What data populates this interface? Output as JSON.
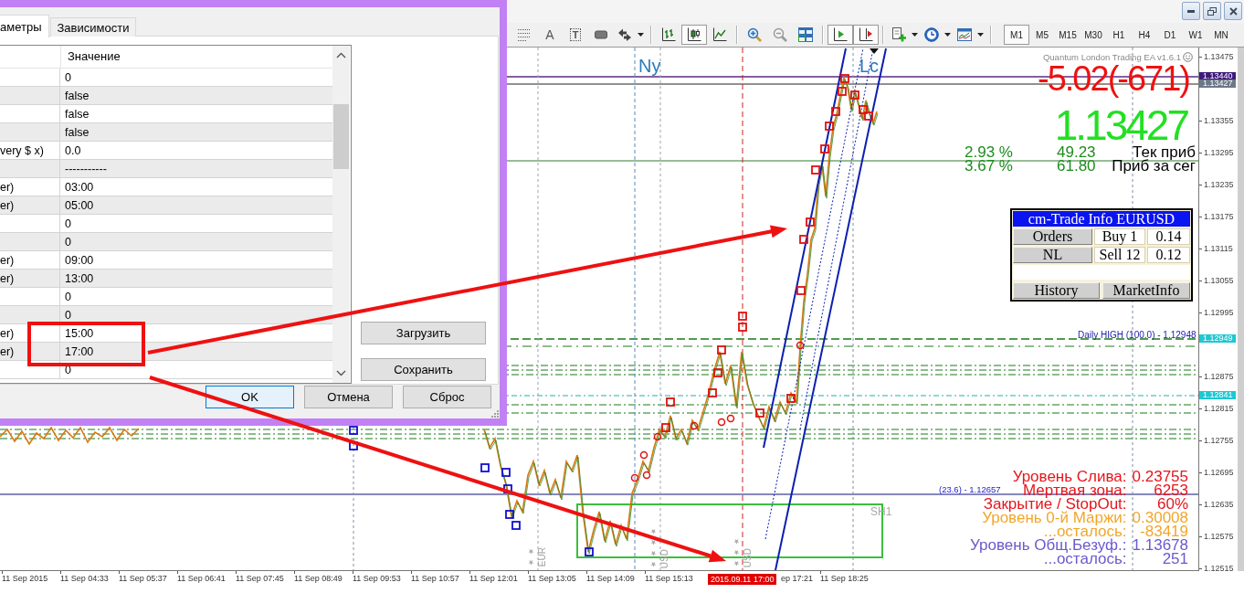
{
  "dialog": {
    "tabs": [
      {
        "label": "аметры",
        "selected": true
      },
      {
        "label": "Зависимости",
        "selected": false
      }
    ],
    "value_header": "Значение",
    "rows": [
      {
        "value": "0"
      },
      {
        "value": "false"
      },
      {
        "value": "false"
      },
      {
        "value": "false"
      },
      {
        "name": "very $ x)",
        "value": "0.0"
      },
      {
        "value": "-----------"
      },
      {
        "name": "er)",
        "value": "03:00"
      },
      {
        "name": "er)",
        "value": "05:00"
      },
      {
        "value": "0"
      },
      {
        "value": "0"
      },
      {
        "name": "er)",
        "value": "09:00"
      },
      {
        "name": "er)",
        "value": "13:00"
      },
      {
        "value": "0"
      },
      {
        "value": "0"
      },
      {
        "name": "er)",
        "value": "15:00"
      },
      {
        "name": "er)",
        "value": "17:00"
      },
      {
        "value": "0"
      }
    ],
    "side_buttons": [
      "Загрузить",
      "Сохранить"
    ],
    "buttons": [
      {
        "label": "OK",
        "focused": true
      },
      {
        "label": "Отмена",
        "focused": false
      },
      {
        "label": "Сброс",
        "focused": false
      }
    ]
  },
  "toolbar": {
    "tools": [
      {
        "kind": "fibo",
        "pressed": false,
        "menu": false
      },
      {
        "kind": "text",
        "label": "A",
        "pressed": false,
        "menu": false
      },
      {
        "kind": "text_label",
        "label": "T",
        "pressed": false,
        "menu": false
      },
      {
        "kind": "rectangle",
        "pressed": false,
        "menu": false
      },
      {
        "kind": "arrows",
        "pressed": false,
        "menu": true
      },
      {
        "kind": "separator"
      },
      {
        "kind": "bar_chart",
        "pressed": false,
        "menu": false
      },
      {
        "kind": "candlesticks",
        "pressed": true,
        "menu": false
      },
      {
        "kind": "line_chart",
        "pressed": false,
        "menu": false
      },
      {
        "kind": "separator"
      },
      {
        "kind": "zoom_in",
        "pressed": false,
        "menu": false
      },
      {
        "kind": "zoom_out",
        "pressed": false,
        "menu": false
      },
      {
        "kind": "tile_windows",
        "pressed": false,
        "menu": false
      },
      {
        "kind": "separator"
      },
      {
        "kind": "auto_scroll",
        "pressed": true,
        "menu": false
      },
      {
        "kind": "chart_shift",
        "pressed": true,
        "menu": false
      },
      {
        "kind": "separator"
      },
      {
        "kind": "indicators",
        "pressed": false,
        "menu": true
      },
      {
        "kind": "periods",
        "pressed": false,
        "menu": true
      },
      {
        "kind": "templates",
        "pressed": false,
        "menu": true
      },
      {
        "kind": "separator"
      }
    ],
    "timeframes": [
      {
        "label": "M1",
        "selected": true
      },
      {
        "label": "M5",
        "selected": false
      },
      {
        "label": "M15",
        "selected": false
      },
      {
        "label": "M30",
        "selected": false
      },
      {
        "label": "H1",
        "selected": false
      },
      {
        "label": "H4",
        "selected": false
      },
      {
        "label": "D1",
        "selected": false
      },
      {
        "label": "W1",
        "selected": false
      },
      {
        "label": "MN",
        "selected": false
      }
    ]
  },
  "chart": {
    "session_labels": [
      "Ny",
      "Lc"
    ],
    "ea_name": "Quantum London Trading EA v1.6.1",
    "profit": "-5.02(-671)",
    "price": "1.13427",
    "stats": [
      {
        "percent": "2.93 %",
        "amount": "49.23",
        "label": "Тек приб"
      },
      {
        "percent": "3.67 %",
        "amount": "61.80",
        "label": "Приб за сег"
      }
    ],
    "trade_panel": {
      "title": "cm-Trade Info EURUSD",
      "rows": [
        {
          "button": "Orders",
          "side": "Buy 1",
          "lots": "0.14"
        },
        {
          "button": "NL",
          "side": "Sell 12",
          "lots": "0.12"
        }
      ],
      "footer_buttons": [
        "History",
        "MarketInfo"
      ]
    },
    "daily_high_label": "Daily HIGH (100.0) - 1.12948",
    "fibo_label": "(23.6) - 1.12657",
    "range_label": "SH1",
    "news_events": [
      {
        "importance": "★★",
        "currency": "EUR"
      },
      {
        "importance": "★★★★",
        "currency": "USD"
      },
      {
        "importance": "★★★",
        "currency": "USD"
      }
    ],
    "account_info": [
      {
        "label": "Уровень Слива:",
        "value": "0.23755",
        "color": "#e5161c"
      },
      {
        "label": "Мертвая зона:",
        "value": "6253",
        "color": "#e5161c"
      },
      {
        "label": "Закрытие / StopOut:",
        "value": "60%",
        "color": "#e5161c"
      },
      {
        "label": "Уровень 0-й Маржи:",
        "value": "0.30008",
        "color": "#f2a62a"
      },
      {
        "label": "...осталось:",
        "value": "-83419",
        "color": "#f2a62a"
      },
      {
        "label": "Уровень Общ.Безуф.:",
        "value": "1.13678",
        "color": "#6a5acd"
      },
      {
        "label": "...осталось:",
        "value": "251",
        "color": "#6a5acd"
      }
    ]
  },
  "price_axis": {
    "labels": [
      "1.13475",
      "1.13355",
      "1.13295",
      "1.13235",
      "1.13175",
      "1.13115",
      "1.13055",
      "1.12995",
      "1.12875",
      "1.12815",
      "1.12755",
      "1.12695",
      "1.12635",
      "1.12575",
      "1.12515"
    ],
    "tags": [
      {
        "label": "1.13440",
        "color": "#3d1a78"
      },
      {
        "label": "1.13427",
        "color": "#6c7888"
      },
      {
        "label": "1.12949",
        "color": "#1ec8d2"
      },
      {
        "label": "1.12841",
        "color": "#1ec8d2"
      }
    ]
  },
  "time_axis": {
    "labels": [
      "11 Sep 2015",
      "11 Sep 04:33",
      "11 Sep 05:37",
      "11 Sep 06:41",
      "11 Sep 07:45",
      "11 Sep 08:49",
      "11 Sep 09:53",
      "11 Sep 10:57",
      "11 Sep 12:01",
      "11 Sep 13:05",
      "11 Sep 14:09",
      "11 Sep 15:13",
      "ep 17:21",
      "11 Sep 18:25"
    ],
    "cursor_label": "2015.09.11 17:00"
  }
}
